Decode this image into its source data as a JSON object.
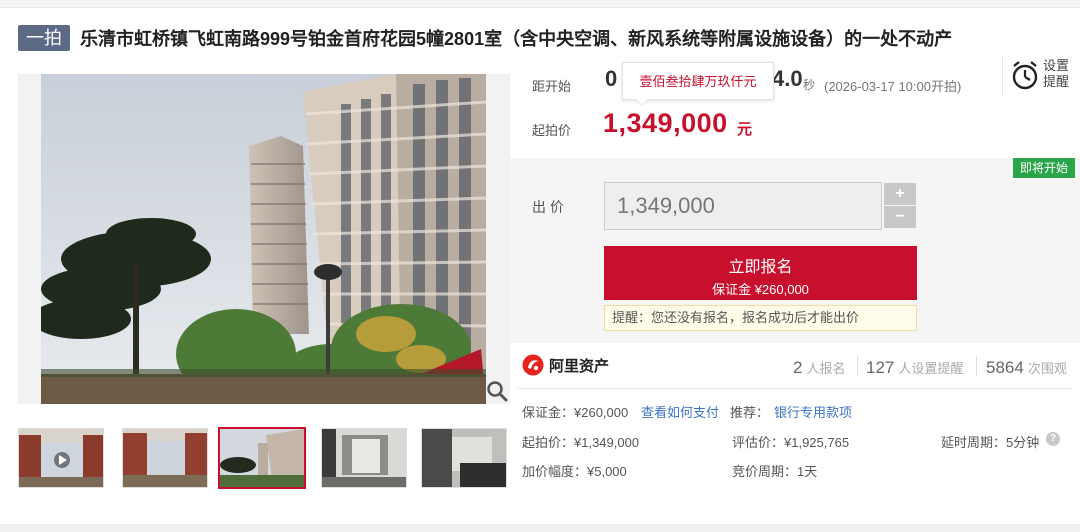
{
  "title": {
    "badge": "一拍",
    "text": "乐清市虹桥镇飞虹南路999号铂金首府花园5幢2801室（含中央空调、新风系统等附属设施设备）的一处不动产"
  },
  "countdown": {
    "label": "距开始",
    "digit_left": "0",
    "digit_right": "4.0",
    "unit": "秒",
    "start_time": "(2026-03-17 10:00开拍)",
    "tooltip": "壹佰叁拾肆万玖仟元"
  },
  "reminder": {
    "label": "设置提醒",
    "icon": "alarm-clock-icon"
  },
  "start_price": {
    "label": "起拍价",
    "value": "1,349,000",
    "unit": "元"
  },
  "status_tag": "即将开始",
  "bid": {
    "label": "出 价",
    "value": "1,349,000",
    "plus": "+",
    "minus": "−",
    "signup_label": "立即报名",
    "signup_deposit": "保证金 ¥260,000",
    "tip": "提醒：您还没有报名，报名成功后才能出价"
  },
  "brand": {
    "name": "阿里资产",
    "color": "#e8231e"
  },
  "stats": [
    {
      "value": "2",
      "label": "人报名"
    },
    {
      "value": "127",
      "label": "人设置提醒"
    },
    {
      "value": "5864",
      "label": "次围观"
    }
  ],
  "details": {
    "deposit": "保证金：¥260,000",
    "pay_link": "查看如何支付",
    "recommend_label": "推荐：",
    "recommend_link": "银行专用款项",
    "start_price": "起拍价：¥1,349,000",
    "appraisal": "评估价：¥1,925,765",
    "delay": "延时周期：5分钟",
    "increment": "加价幅度：¥5,000",
    "bid_period": "竞价周期：1天"
  },
  "colors": {
    "accent": "#c8102e",
    "badge": "#5d6a86",
    "status": "#2aa54a",
    "link": "#3b74c4"
  }
}
